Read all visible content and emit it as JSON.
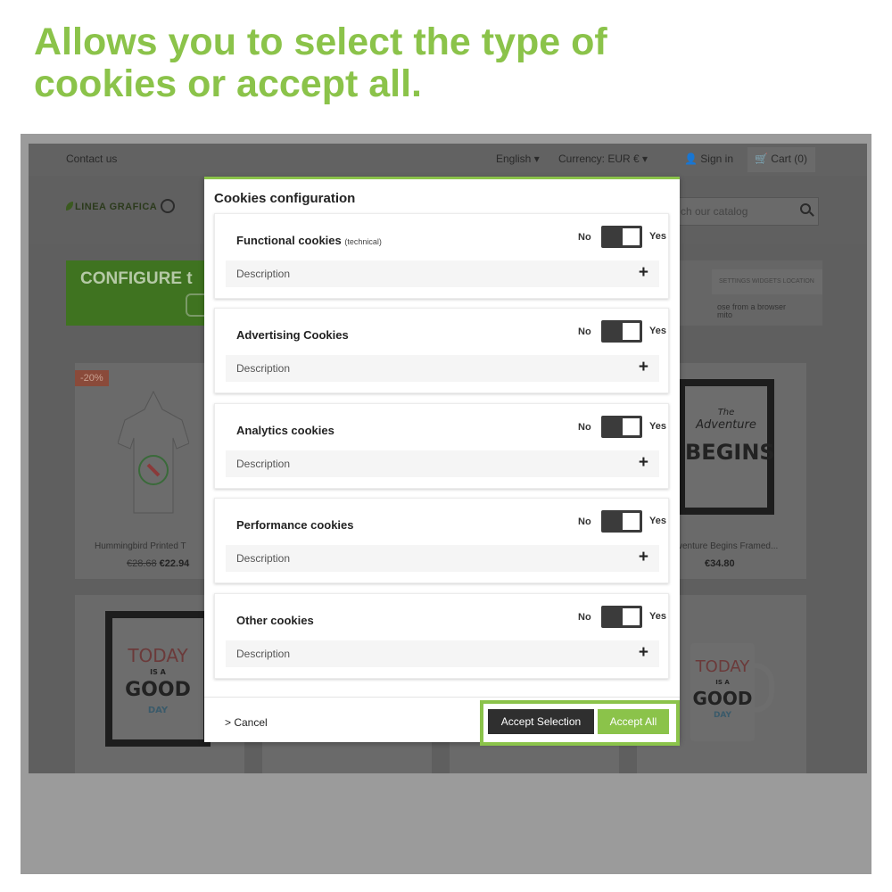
{
  "headline": {
    "line1": "Allows you to select the type of",
    "line2": "cookies or accept all."
  },
  "site": {
    "topbar": {
      "contact": "Contact us",
      "language": "English ▾",
      "currency": "Currency: EUR € ▾",
      "signin": "Sign in",
      "cart": "Cart (0)"
    },
    "logo_text": "LINEA GRAFICA",
    "search_placeholder": "ch our catalog",
    "banner": {
      "text": "CONFIGURE t",
      "right_tabs": "SETTINGS    WIDGETS LOCATION",
      "right_text1": "ose from a browser",
      "right_text2": "mito"
    },
    "products": [
      {
        "discount": "-20%",
        "name": "Hummingbird Printed T",
        "old_price": "€28.68",
        "price": "€22.94"
      },
      {
        "name": "venture Begins Framed...",
        "price": "€34.80"
      }
    ],
    "posters": {
      "adventure_line1": "The",
      "adventure_line2": "Adventure",
      "adventure_line3": "BEGINS",
      "today1": "TODAY",
      "today2": "IS A",
      "today3": "GOOD",
      "today4": "DAY"
    }
  },
  "modal": {
    "title": "Cookies configuration",
    "categories": [
      {
        "name": "Functional cookies",
        "note": "(technical)",
        "no": "No",
        "yes": "Yes",
        "description": "Description",
        "enabled": true
      },
      {
        "name": "Advertising Cookies",
        "note": "",
        "no": "No",
        "yes": "Yes",
        "description": "Description",
        "enabled": true
      },
      {
        "name": "Analytics cookies",
        "note": "",
        "no": "No",
        "yes": "Yes",
        "description": "Description",
        "enabled": true
      },
      {
        "name": "Performance cookies",
        "note": "",
        "no": "No",
        "yes": "Yes",
        "description": "Description",
        "enabled": true
      },
      {
        "name": "Other cookies",
        "note": "",
        "no": "No",
        "yes": "Yes",
        "description": "Description",
        "enabled": true
      }
    ],
    "expand_symbol": "+",
    "cancel": "> Cancel",
    "accept_selection": "Accept Selection",
    "accept_all": "Accept All"
  },
  "colors": {
    "accent": "#8bc34a",
    "dark_button": "#2f2f2f",
    "toggle": "#3b3b3b"
  }
}
